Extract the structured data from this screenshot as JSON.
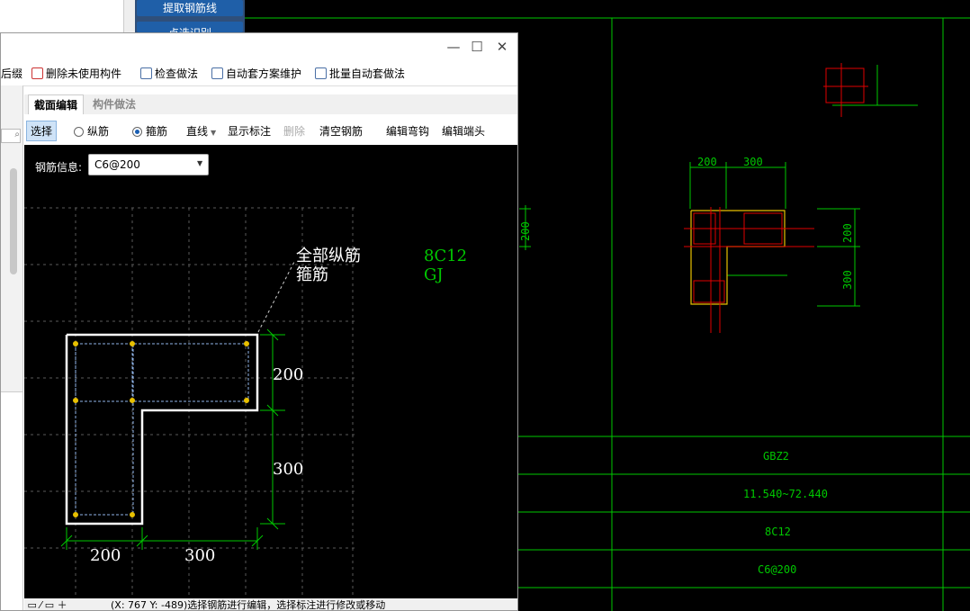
{
  "background_app": {
    "btn_extract": "提取钢筋线",
    "btn_identify": "点选识别"
  },
  "toolbar": {
    "partial_left": "后缀",
    "delete_unused": "删除未使用构件",
    "check_method": "检查做法",
    "auto_scheme": "自动套方案维护",
    "batch_auto": "批量自动套做法"
  },
  "tabs": {
    "section_edit": "截面编辑",
    "component_method": "构件做法"
  },
  "options": {
    "select": "选择",
    "longitudinal": "纵筋",
    "stirrup": "箍筋",
    "line_mode": "直线",
    "show_dim": "显示标注",
    "delete": "删除",
    "clear_rebar": "清空钢筋",
    "edit_hook": "编辑弯钩",
    "edit_end": "编辑端头"
  },
  "rebar_info": {
    "label": "钢筋信息:",
    "value": "C6@200"
  },
  "section_drawing": {
    "all_long_label": "全部纵筋",
    "stirrup_label": "箍筋",
    "all_long_value": "8C12",
    "stirrup_value": "GJ",
    "dim_h1": "200",
    "dim_h2": "300",
    "dim_w1": "200",
    "dim_w2": "300"
  },
  "status": {
    "coords": "(X: 767 Y: -489)选择钢筋进行编辑，选择标注进行修改或移动"
  },
  "cad": {
    "dim_top1": "200",
    "dim_top2": "300",
    "dim_right1": "200",
    "dim_right2": "300",
    "table_name": "GBZ2",
    "table_elev": "11.540~72.440",
    "table_long": "8C12",
    "table_stirrup": "C6@200",
    "side_dim": "200"
  },
  "colors": {
    "cad_green": "#00c800",
    "cad_red": "#e00000",
    "cad_yellow": "#e8c000",
    "accent_blue": "#1f5fa8"
  }
}
